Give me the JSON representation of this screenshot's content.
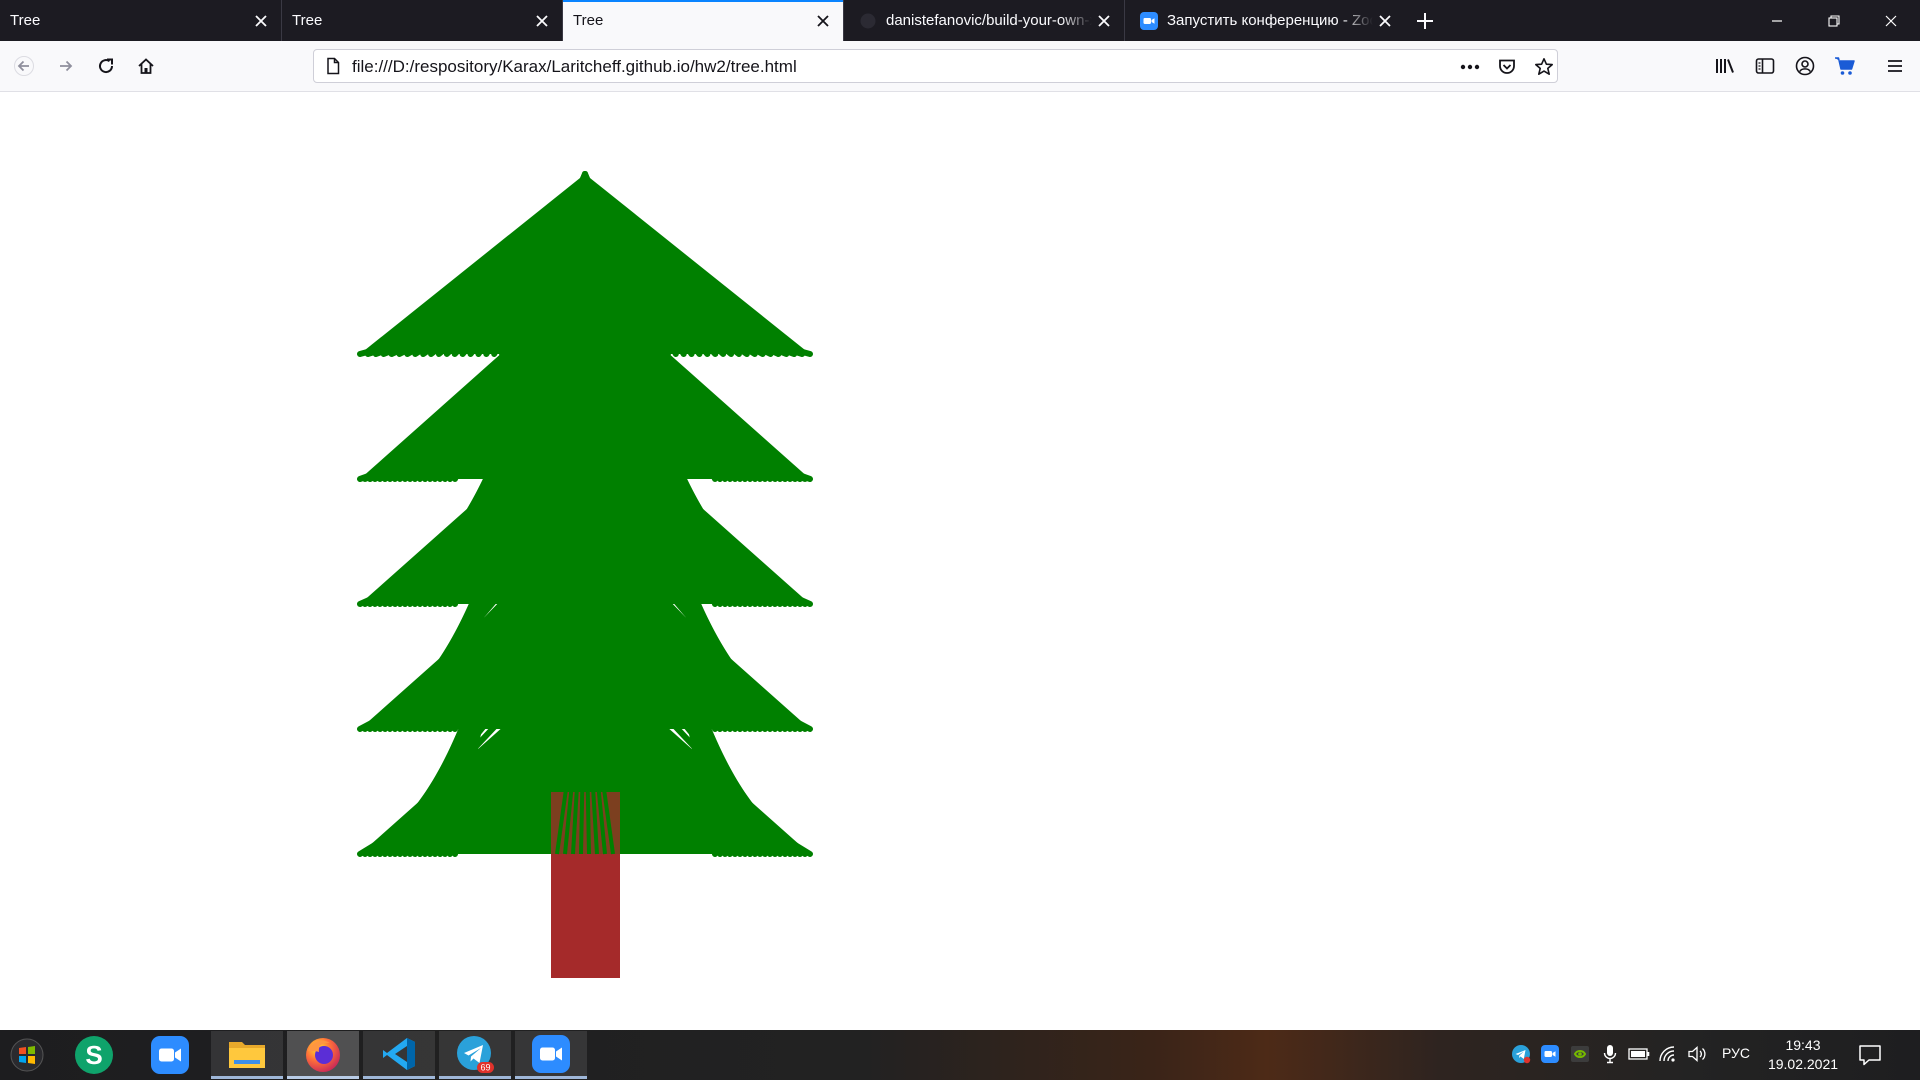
{
  "browser": {
    "tabs": [
      {
        "title": "Tree",
        "active": false,
        "icon": "none"
      },
      {
        "title": "Tree",
        "active": false,
        "icon": "none"
      },
      {
        "title": "Tree",
        "active": true,
        "icon": "none"
      },
      {
        "title": "danistefanovic/build-your-own-x",
        "active": false,
        "icon": "github-icon"
      },
      {
        "title": "Запустить конференцию - Zoom",
        "active": false,
        "icon": "zoom-icon"
      }
    ],
    "url": "file:///D:/respository/Karax/Laritcheff.github.io/hw2/tree.html"
  },
  "page": {
    "tree": {
      "foliage_color": "#008000",
      "trunk_color": "#a52a2a",
      "tiers": 5,
      "branches_per_side": 20
    }
  },
  "taskbar": {
    "apps": [
      "skype-icon",
      "zoom-icon",
      "file-explorer-icon",
      "firefox-icon",
      "vscode-icon",
      "telegram-icon",
      "zoom-icon"
    ],
    "telegram_badge": "69",
    "language": "РУС",
    "time": "19:43",
    "date": "19.02.2021"
  },
  "colors": {
    "accent": "#0a84ff",
    "tabstrip": "#1c1b22",
    "toolbar": "#f9f9fb"
  }
}
